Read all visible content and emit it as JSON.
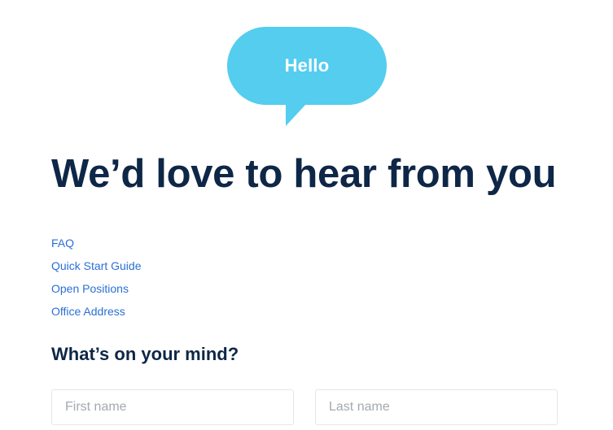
{
  "colors": {
    "bubble": "#54cdef",
    "navy": "#0e2747",
    "link": "#2b6fd6"
  },
  "bubble": {
    "text": "Hello"
  },
  "headline": "We’d love to hear from you",
  "links": [
    {
      "label": "FAQ"
    },
    {
      "label": "Quick Start Guide"
    },
    {
      "label": "Open Positions"
    },
    {
      "label": "Office Address"
    }
  ],
  "form": {
    "title": "What’s on your mind?",
    "first_name": {
      "placeholder": "First name",
      "value": ""
    },
    "last_name": {
      "placeholder": "Last name",
      "value": ""
    }
  }
}
